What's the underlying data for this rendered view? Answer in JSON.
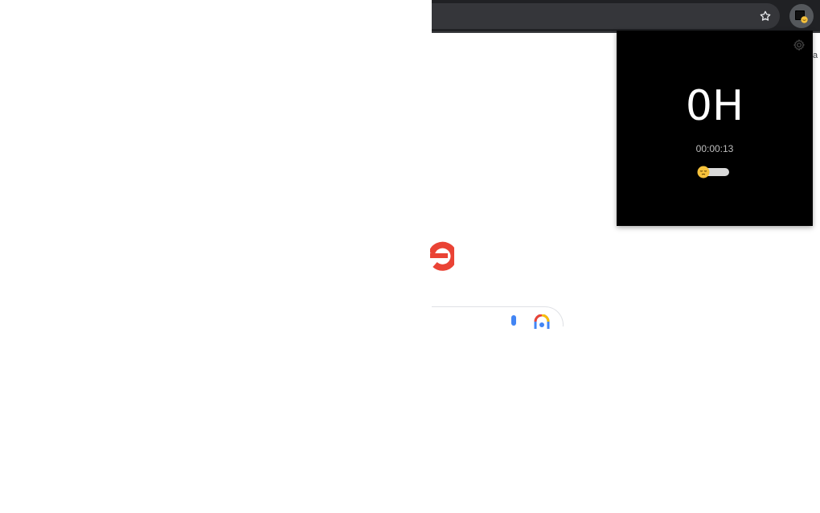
{
  "extension_popup": {
    "main_value": "0H",
    "timer": "00:00:13",
    "toggle_state": "off",
    "settings_icon": "gear-icon",
    "toggle_knob_icon": "sleepy-face-emoji-icon"
  },
  "browser_toolbar": {
    "bookmark_icon": "star-icon",
    "extension_icon": "extension-icon"
  },
  "google_page": {
    "mic_icon": "microphone-icon",
    "lens_icon": "google-lens-icon",
    "edge_fragment": "a"
  },
  "colors": {
    "popup_background": "#000000",
    "toolbar_background": "#202124",
    "google_red": "#EA4335",
    "google_blue": "#4285F4"
  }
}
